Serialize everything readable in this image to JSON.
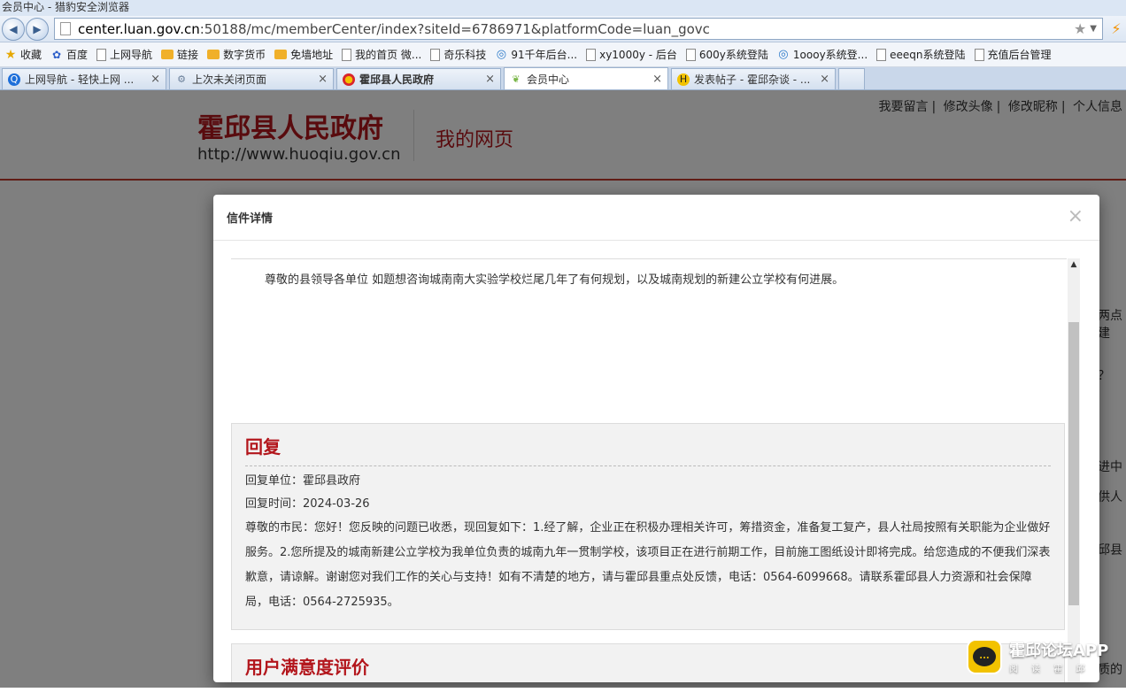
{
  "window": {
    "title": "会员中心 - 猎豹安全浏览器"
  },
  "nav": {
    "back_icon": "back-arrow-icon",
    "forward_icon": "forward-arrow-icon",
    "url_host": "center.luan.gov.cn",
    "url_rest": ":50188/mc/memberCenter/index?siteId=6786971&platformCode=luan_govc"
  },
  "bookmarks": [
    {
      "label": "收藏",
      "icon": "star-icon"
    },
    {
      "label": "百度",
      "icon": "baidu-paw-icon"
    },
    {
      "label": "上网导航",
      "icon": "page-icon"
    },
    {
      "label": "链接",
      "icon": "folder-icon"
    },
    {
      "label": "数字货币",
      "icon": "folder-icon"
    },
    {
      "label": "免墙地址",
      "icon": "folder-icon"
    },
    {
      "label": "我的首页 微...",
      "icon": "page-icon"
    },
    {
      "label": "奇乐科技",
      "icon": "page-icon"
    },
    {
      "label": "91千年后台...",
      "icon": "spiral-icon"
    },
    {
      "label": "xy1000y - 后台",
      "icon": "page-icon"
    },
    {
      "label": "600y系统登陆",
      "icon": "page-icon"
    },
    {
      "label": "1oooy系统登...",
      "icon": "spiral-icon"
    },
    {
      "label": "eeeqn系统登陆",
      "icon": "page-icon"
    },
    {
      "label": "充值后台管理",
      "icon": "page-icon"
    }
  ],
  "tabs": [
    {
      "label": "上网导航 - 轻快上网 ...",
      "active": false
    },
    {
      "label": "上次未关闭页面",
      "active": false
    },
    {
      "label": "霍邱县人民政府",
      "active": false
    },
    {
      "label": "会员中心",
      "active": true
    },
    {
      "label": "发表帖子 - 霍邱杂谈 - ...",
      "active": false
    }
  ],
  "site": {
    "title": "霍邱县人民政府",
    "url": "http://www.huoqiu.gov.cn",
    "subtitle": "我的网页",
    "links": [
      "我要留言",
      "修改头像",
      "修改昵称",
      "个人信息"
    ]
  },
  "background": {
    "frag1": "两点建",
    "frag2": "？",
    "frag3": "进中",
    "frag4": "供人",
    "frag5": "邱县",
    "frag6": "质的"
  },
  "modal": {
    "title": "信件详情",
    "close": "×",
    "letter": "尊敬的县领导各单位 如题想咨询城南南大实验学校烂尾几年了有何规划，以及城南规划的新建公立学校有何进展。",
    "reply": {
      "heading": "回复",
      "unit": "回复单位：霍邱县政府",
      "time": "回复时间：2024-03-26",
      "content": "尊敬的市民：您好！您反映的问题已收悉，现回复如下：1.经了解，企业正在积极办理相关许可，筹措资金，准备复工复产，县人社局按照有关职能为企业做好服务。2.您所提及的城南新建公立学校为我单位负责的城南九年一贯制学校，该项目正在进行前期工作，目前施工图纸设计即将完成。给您造成的不便我们深表歉意，请谅解。谢谢您对我们工作的关心与支持！如有不清楚的地方，请与霍邱县重点处反馈，电话：0564-6099668。请联系霍邱县人力资源和社会保障局，电话：0564-2725935。"
    },
    "rating_heading": "用户满意度评价"
  },
  "watermark": {
    "title": "霍邱论坛APP",
    "sub": "阅 读 霍 邱",
    "badge": "..."
  }
}
